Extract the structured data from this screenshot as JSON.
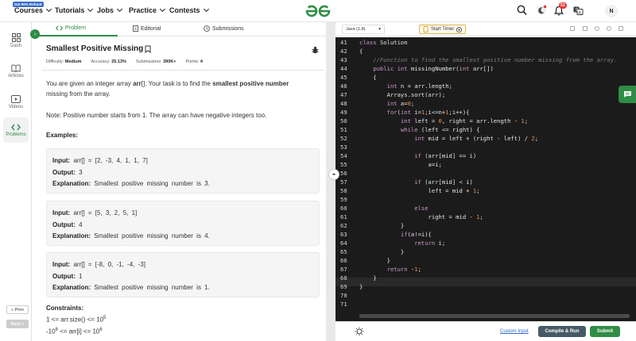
{
  "nav": {
    "offer_badge": "Get 90% Refund",
    "items": [
      {
        "label": "Courses"
      },
      {
        "label": "Tutorials"
      },
      {
        "label": "Jobs"
      },
      {
        "label": "Practice"
      },
      {
        "label": "Contests"
      }
    ],
    "notification_count": "53",
    "avatar_initial": "N"
  },
  "sidebar": {
    "items": [
      {
        "label": "Dash",
        "icon": "dashboard-icon"
      },
      {
        "label": "Articles",
        "icon": "book-icon"
      },
      {
        "label": "Videos",
        "icon": "video-icon"
      },
      {
        "label": "Problems",
        "icon": "code-icon"
      }
    ],
    "prev_label": "« Prev",
    "next_label": "Next »"
  },
  "tabs": [
    {
      "label": "Problem",
      "icon": "code-icon"
    },
    {
      "label": "Editorial",
      "icon": "document-icon"
    },
    {
      "label": "Submissions",
      "icon": "clock-icon"
    }
  ],
  "problem": {
    "title": "Smallest Positive Missing",
    "difficulty_label": "Difficulty:",
    "difficulty": "Medium",
    "accuracy_label": "Accuracy:",
    "accuracy": "25.13%",
    "submissions_label": "Submissions:",
    "submissions": "390K+",
    "points_label": "Points:",
    "points": "4",
    "desc_1": "You are given an integer array ",
    "desc_arr": "arr",
    "desc_2": "[]. Your task is to find the ",
    "desc_bold": "smallest positive number",
    "desc_3": " missing from the array.",
    "note": "Note: Positive number starts from 1. The array can have negative integers too.",
    "examples_heading": "Examples:",
    "examples": [
      {
        "input": "arr[] = [2, -3, 4, 1, 1, 7]",
        "output": "3",
        "explanation": "Smallest positive missing number is 3."
      },
      {
        "input": "arr[] = [5, 3, 2, 5, 1]",
        "output": "4",
        "explanation": "Smallest positive missing number is 4."
      },
      {
        "input": "arr[] = [-8, 0, -1, -4, -3]",
        "output": "1",
        "explanation": "Smallest positive missing number is 1."
      }
    ],
    "input_label": "Input:",
    "output_label": "Output:",
    "explanation_label": "Explanation:",
    "constraints_heading": "Constraints:",
    "constraint_1_pre": "1 <= arr.size() <= 10",
    "constraint_1_exp": "5",
    "constraint_2_pre": "-10",
    "constraint_2_exp": "6",
    "constraint_2_mid": " <= arr[i] <= 10",
    "constraint_2_exp2": "6"
  },
  "editor": {
    "language": "Java (1.8)",
    "timer_label": "Start Timer",
    "code_lines": [
      {
        "n": "41",
        "t": "class Solution"
      },
      {
        "n": "42",
        "t": "{"
      },
      {
        "n": "43",
        "t": "    //Function to find the smallest positive number missing from the array."
      },
      {
        "n": "44",
        "t": "    public int missingNumber(int arr[])"
      },
      {
        "n": "45",
        "t": "    {"
      },
      {
        "n": "46",
        "t": "        int n = arr.length;"
      },
      {
        "n": "47",
        "t": "        Arrays.sort(arr);"
      },
      {
        "n": "48",
        "t": "        int a=0;"
      },
      {
        "n": "49",
        "t": "        for(int i=1;i<=n+1;i++){"
      },
      {
        "n": "50",
        "t": "            int left = 0, right = arr.length - 1;"
      },
      {
        "n": "51",
        "t": "            while (left <= right) {"
      },
      {
        "n": "52",
        "t": "                int mid = left + (right - left) / 2;"
      },
      {
        "n": "53",
        "t": ""
      },
      {
        "n": "54",
        "t": "                if (arr[mid] == i)"
      },
      {
        "n": "55",
        "t": "                    a=i;"
      },
      {
        "n": "56",
        "t": ""
      },
      {
        "n": "57",
        "t": "                if (arr[mid] < i)"
      },
      {
        "n": "58",
        "t": "                    left = mid + 1;"
      },
      {
        "n": "59",
        "t": ""
      },
      {
        "n": "60",
        "t": "                else"
      },
      {
        "n": "61",
        "t": "                    right = mid - 1;"
      },
      {
        "n": "62",
        "t": "            }"
      },
      {
        "n": "63",
        "t": "            if(a!=i){"
      },
      {
        "n": "64",
        "t": "                return i;"
      },
      {
        "n": "65",
        "t": "            }"
      },
      {
        "n": "66",
        "t": "        }"
      },
      {
        "n": "67",
        "t": "        return -1;"
      },
      {
        "n": "68",
        "t": "    }"
      },
      {
        "n": "69",
        "t": "}"
      },
      {
        "n": "70",
        "t": ""
      },
      {
        "n": "71",
        "t": ""
      }
    ],
    "custom_input_label": "Custom Input",
    "compile_label": "Compile & Run",
    "submit_label": "Submit"
  },
  "colors": {
    "brand_green": "#2f8d46",
    "editor_bg": "#1b1b1b",
    "keyword": "#cc99cd",
    "number": "#f08d49",
    "comment": "#7c7c7c"
  }
}
